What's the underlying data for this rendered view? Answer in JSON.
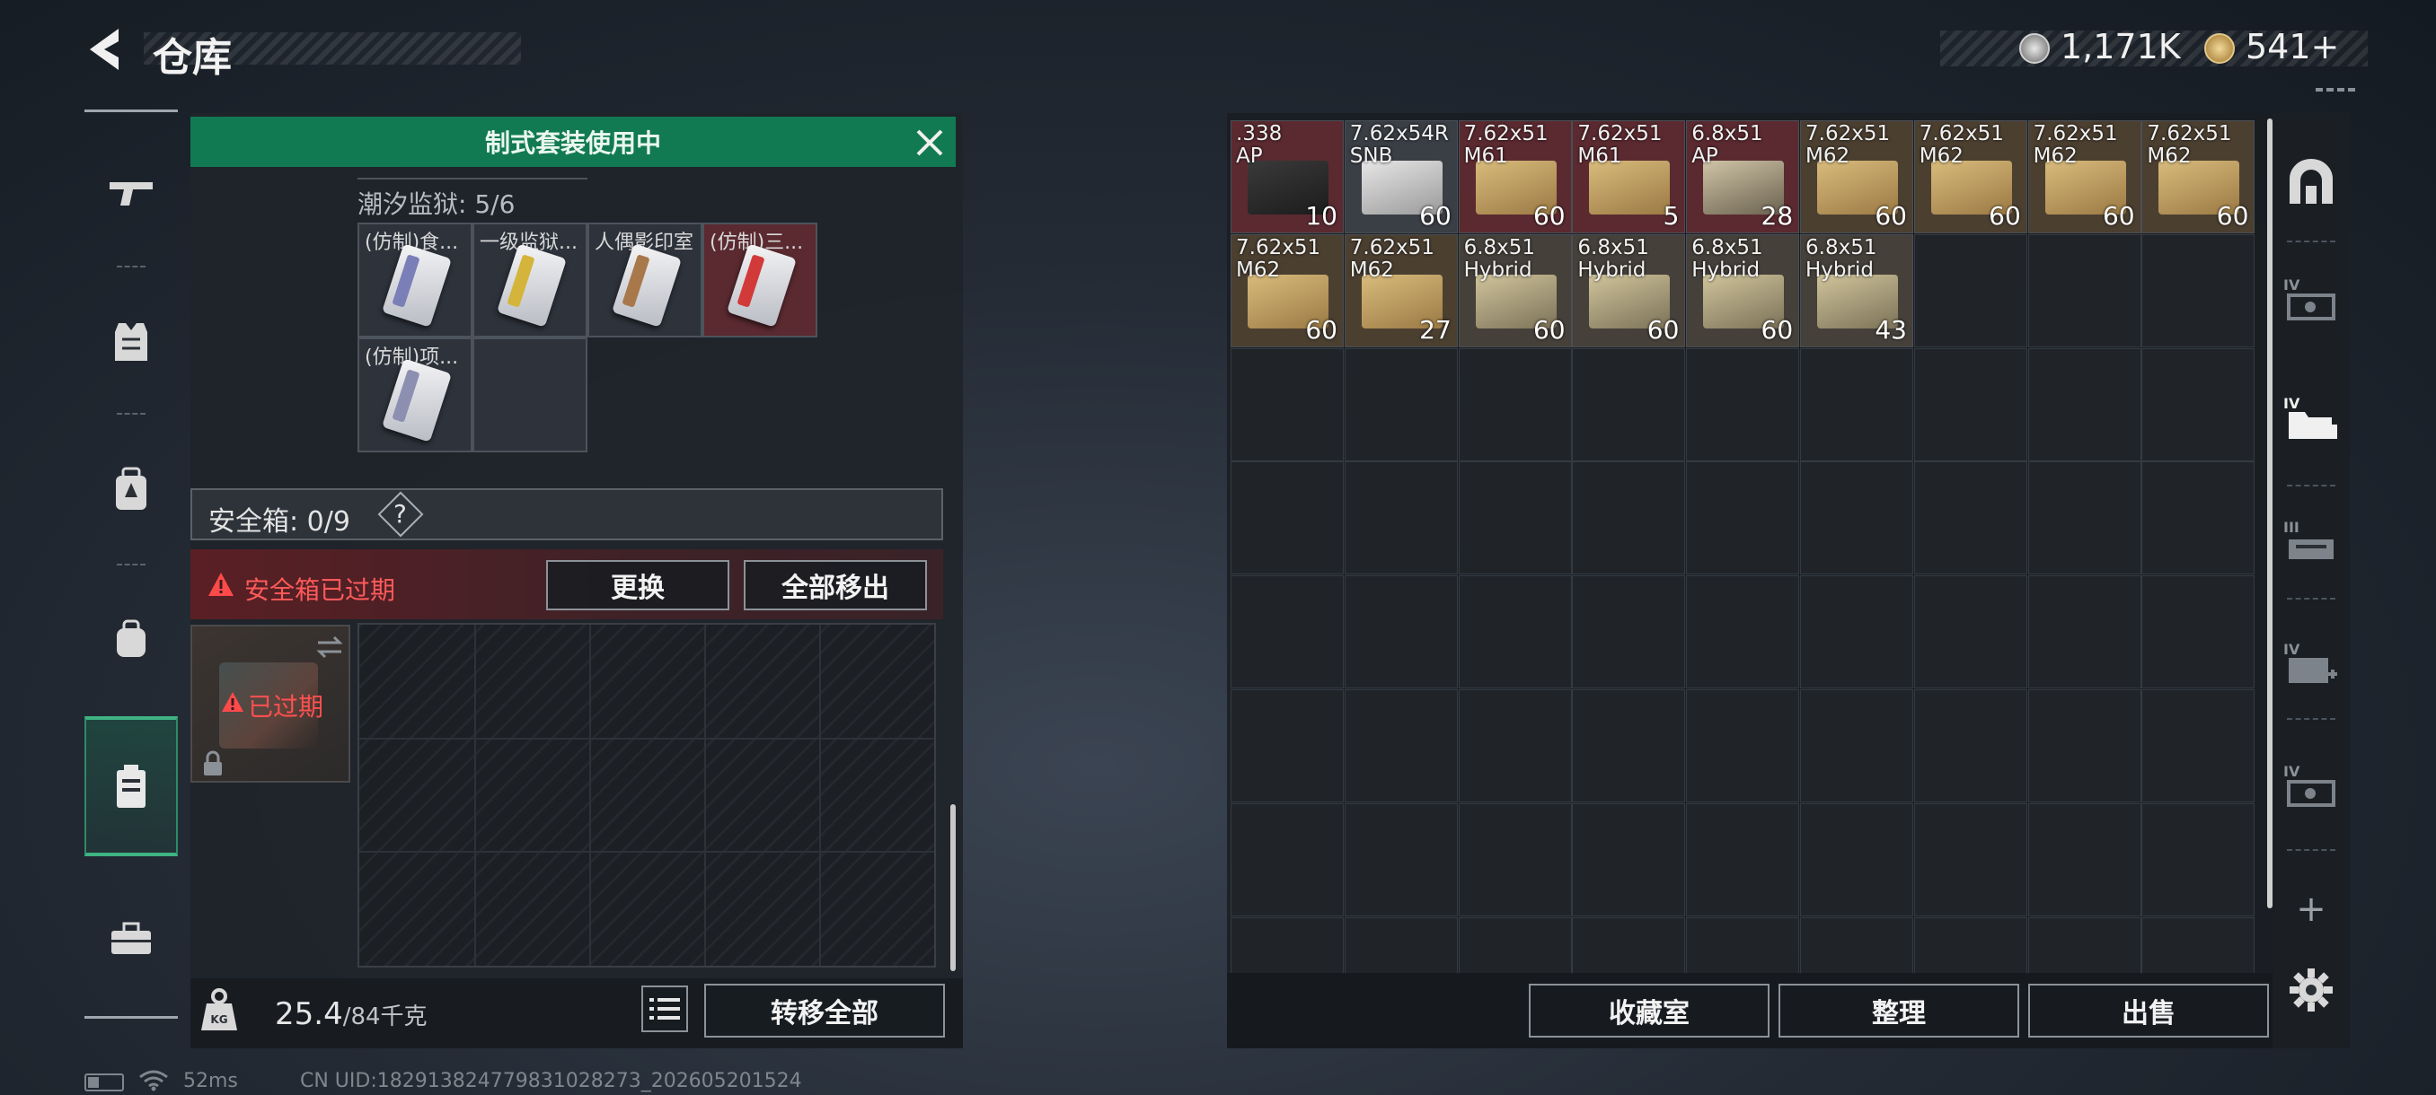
{
  "header": {
    "title": "仓库",
    "currencies": [
      {
        "icon": "silver-coin-icon",
        "value": "1,171K"
      },
      {
        "icon": "gold-coin-icon",
        "value": "541+"
      }
    ]
  },
  "left_rail": {
    "items": [
      {
        "icon": "gun-icon",
        "active": false
      },
      {
        "icon": "vest-icon",
        "active": false
      },
      {
        "icon": "backpack-armor-icon",
        "active": false
      },
      {
        "icon": "bag-icon",
        "active": false
      },
      {
        "icon": "safebox-icon",
        "active": true
      },
      {
        "icon": "toolbox-icon",
        "active": false
      }
    ]
  },
  "equip_panel": {
    "banner": "制式套装使用中",
    "set_title": "潮汐监狱: 5/6",
    "slots": [
      {
        "label": "(仿制)食...",
        "stripe": "#7b7fb8",
        "bg": "#2d323b"
      },
      {
        "label": "一级监狱...",
        "stripe": "#d4b43a",
        "bg": "#2d323b"
      },
      {
        "label": "人偶影印室",
        "stripe": "#a8784a",
        "bg": "#2d323b"
      },
      {
        "label": "(仿制)三...",
        "stripe": "#d23a3a",
        "bg": "#5a2a30"
      },
      {
        "label": "(仿制)项...",
        "stripe": "#8c8fb0",
        "bg": "#2d323b"
      }
    ],
    "safebox_label": "安全箱: 0/9",
    "help": "?",
    "expired_warning": "安全箱已过期",
    "replace_button": "更换",
    "remove_all_button": "全部移出",
    "case_status": "已过期",
    "weight_value": "25.4",
    "weight_max": "/84千克",
    "transfer_all_button": "转移全部"
  },
  "storage": {
    "items": [
      {
        "name": ".338\nAP",
        "count": "10",
        "bg": "#5a2a30",
        "box": "dark"
      },
      {
        "name": "7.62x54R\nSNB",
        "count": "60",
        "bg": "#3a3e45",
        "box": "silver"
      },
      {
        "name": "7.62x51\nM61",
        "count": "60",
        "bg": "#5a2a30",
        "box": "tan"
      },
      {
        "name": "7.62x51\nM61",
        "count": "5",
        "bg": "#5a2a30",
        "box": "tan"
      },
      {
        "name": "6.8x51\nAP",
        "count": "28",
        "bg": "#5a2a30",
        "box": "dark-tan"
      },
      {
        "name": "7.62x51\nM62",
        "count": "60",
        "bg": "#4b3f30",
        "box": "tan"
      },
      {
        "name": "7.62x51\nM62",
        "count": "60",
        "bg": "#4b3f30",
        "box": "tan"
      },
      {
        "name": "7.62x51\nM62",
        "count": "60",
        "bg": "#4b3f30",
        "box": "tan"
      },
      {
        "name": "7.62x51\nM62",
        "count": "60",
        "bg": "#4b3f30",
        "box": "tan"
      },
      {
        "name": "7.62x51\nM62",
        "count": "60",
        "bg": "#4b3f30",
        "box": "tan"
      },
      {
        "name": "7.62x51\nM62",
        "count": "27",
        "bg": "#4b3f30",
        "box": "tan"
      },
      {
        "name": "6.8x51\nHybrid",
        "count": "60",
        "bg": "#45403a",
        "box": "olive"
      },
      {
        "name": "6.8x51\nHybrid",
        "count": "60",
        "bg": "#45403a",
        "box": "olive"
      },
      {
        "name": "6.8x51\nHybrid",
        "count": "60",
        "bg": "#45403a",
        "box": "olive"
      },
      {
        "name": "6.8x51\nHybrid",
        "count": "43",
        "bg": "#45403a",
        "box": "olive"
      }
    ],
    "collection_button": "收藏室",
    "sort_button": "整理",
    "sell_button": "出售"
  },
  "right_rail": {
    "items": [
      {
        "icon": "arch-icon",
        "badge": ""
      },
      {
        "icon": "storage-expansion-icon",
        "badge": "IV"
      },
      {
        "icon": "folder-storage-icon",
        "badge": "IV"
      },
      {
        "icon": "storage-shelf-icon",
        "badge": "III"
      },
      {
        "icon": "medkit-storage-icon",
        "badge": "IV"
      },
      {
        "icon": "safe-storage-icon",
        "badge": "IV"
      }
    ],
    "add": "+"
  },
  "status_bar": {
    "ping": "52ms",
    "uid": "CN UID:1829138247798310282​73_202605201524"
  },
  "colors": {
    "accent_green": "#127a52",
    "warning_red": "#ff5a5a",
    "tan_box": "#c9a86a"
  }
}
